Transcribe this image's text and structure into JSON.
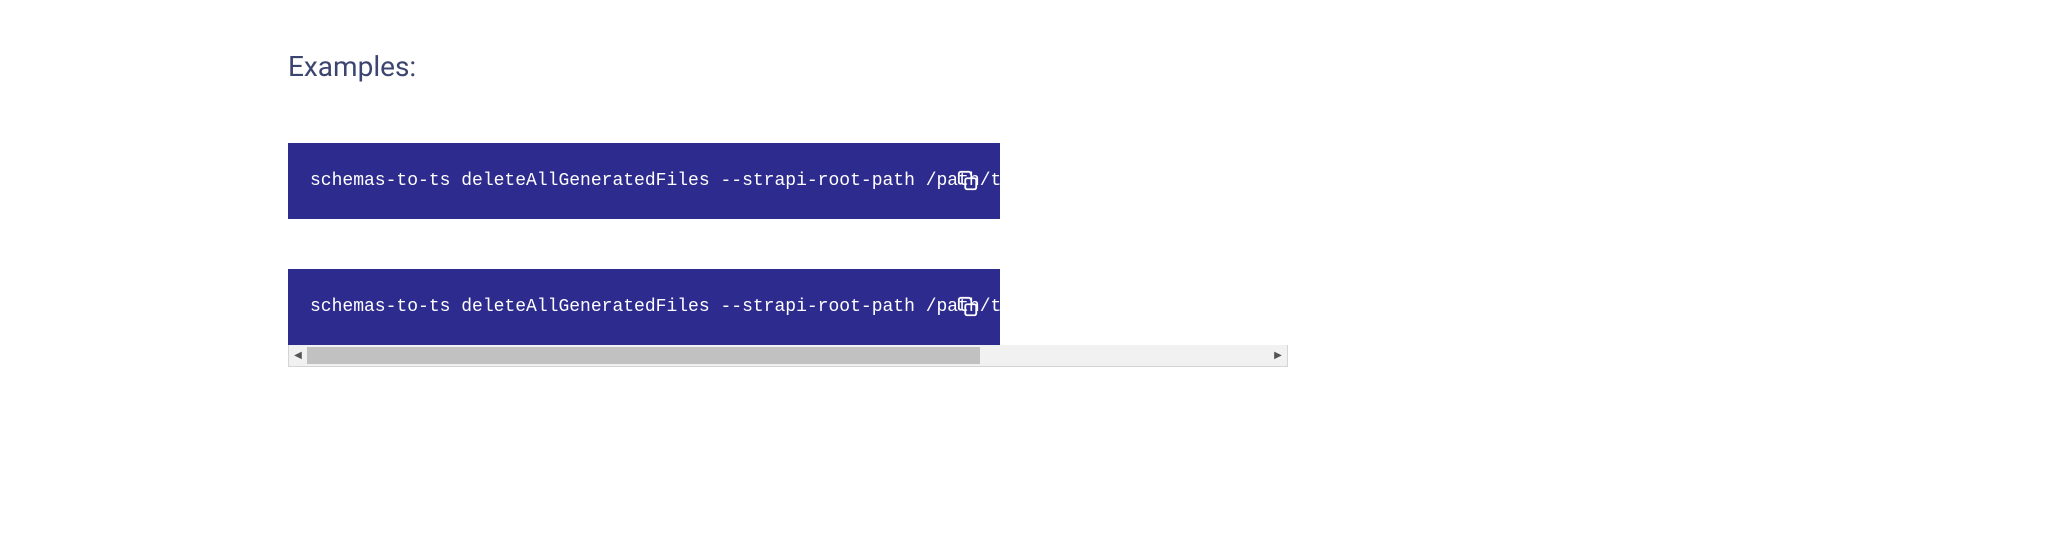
{
  "heading": "Examples:",
  "code_blocks": [
    {
      "command": "schemas-to-ts deleteAllGeneratedFiles --strapi-root-path /path/to/strapi"
    },
    {
      "command": "schemas-to-ts deleteAllGeneratedFiles --strapi-root-path /path/to/strapi --logLevel debug"
    }
  ],
  "colors": {
    "code_background": "#2d2b8e",
    "heading_color": "#3b4570",
    "code_text": "#ffffff"
  }
}
